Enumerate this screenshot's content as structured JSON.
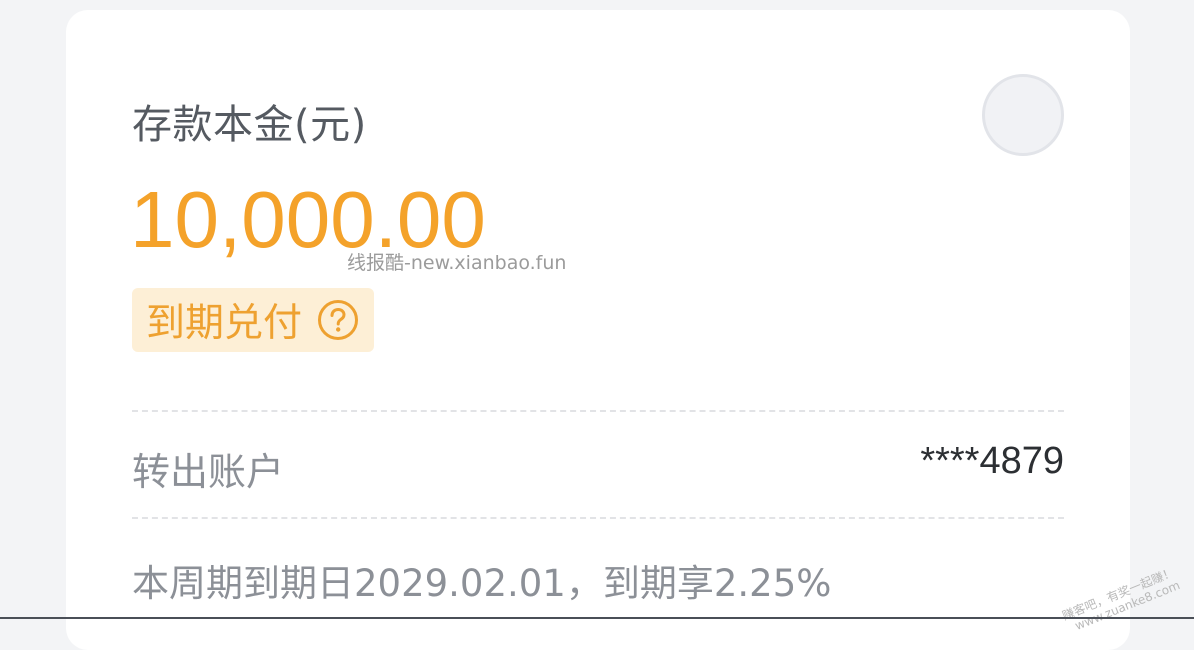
{
  "principal": {
    "label": "存款本金(元)",
    "amount": "10,000.00"
  },
  "badge": {
    "label": "到期兑付",
    "icon": "question-circle-icon",
    "color": "#eea130",
    "background": "#fdefd6"
  },
  "account": {
    "label": "转出账户",
    "value": "****4879"
  },
  "maturity": {
    "text": "本周期到期日2029.02.01，到期享2.25%"
  },
  "watermarks": {
    "center": "线报酷-new.xianbao.fun",
    "corner_line1": "赚客吧，有奖一起赚！",
    "corner_line2": "www.zuanke8.com"
  },
  "colors": {
    "accent": "#f4a22a",
    "text_primary": "#2c2f33",
    "text_secondary": "#8c9097",
    "background": "#f3f4f6",
    "card": "#ffffff"
  }
}
